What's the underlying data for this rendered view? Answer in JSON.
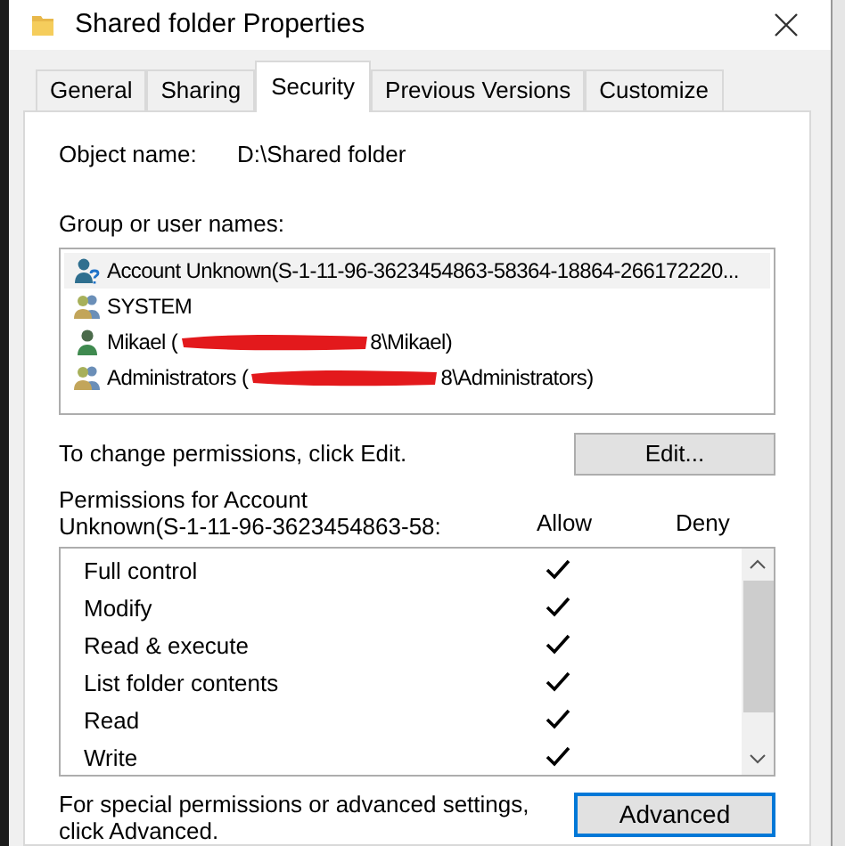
{
  "window": {
    "title": "Shared folder Properties"
  },
  "tabs": [
    {
      "label": "General",
      "selected": false
    },
    {
      "label": "Sharing",
      "selected": false
    },
    {
      "label": "Security",
      "selected": true
    },
    {
      "label": "Previous Versions",
      "selected": false
    },
    {
      "label": "Customize",
      "selected": false
    }
  ],
  "object_name": {
    "label": "Object name:",
    "value": "D:\\Shared folder"
  },
  "users": {
    "label": "Group or user names:",
    "items": [
      {
        "kind": "unknown",
        "text": "Account Unknown(S-1-11-96-3623454863-58364-18864-266172220...",
        "selected": true
      },
      {
        "kind": "group",
        "text": "SYSTEM",
        "selected": false
      },
      {
        "kind": "user",
        "text": "Mikael (",
        "redacted": true,
        "tail": "8\\Mikael)",
        "selected": false
      },
      {
        "kind": "group",
        "text": "Administrators (",
        "redacted": true,
        "tail": "8\\Administrators)",
        "selected": false
      }
    ]
  },
  "edit_hint": "To change permissions, click Edit.",
  "edit_button": "Edit...",
  "permissions": {
    "label_line_1": "Permissions for Account",
    "label_line_2": "Unknown(S-1-11-96-3623454863-58:",
    "allow_header": "Allow",
    "deny_header": "Deny",
    "rows": [
      {
        "name": "Full control",
        "allow": true,
        "deny": false
      },
      {
        "name": "Modify",
        "allow": true,
        "deny": false
      },
      {
        "name": "Read & execute",
        "allow": true,
        "deny": false
      },
      {
        "name": "List folder contents",
        "allow": true,
        "deny": false
      },
      {
        "name": "Read",
        "allow": true,
        "deny": false
      },
      {
        "name": "Write",
        "allow": true,
        "deny": false
      }
    ]
  },
  "advanced_hint_line_1": "For special permissions or advanced settings,",
  "advanced_hint_line_2": "click Advanced.",
  "advanced_button": "Advanced"
}
